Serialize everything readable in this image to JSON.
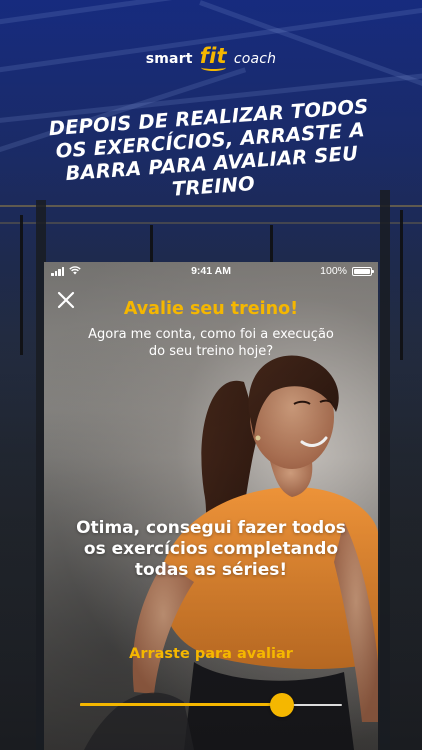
{
  "logo": {
    "smart": "smart",
    "fit": "fit",
    "coach": "coach"
  },
  "headline": "DEPOIS DE REALIZAR TODOS OS EXERCÍCIOS, ARRASTE A BARRA PARA AVALIAR SEU TREINO",
  "status_bar": {
    "time": "9:41 AM",
    "battery_percent": "100%",
    "icons": [
      "signal-icon",
      "wifi-icon",
      "battery-icon"
    ]
  },
  "screen": {
    "close_icon": "close-icon",
    "title": "Avalie seu treino!",
    "subtitle": "Agora me conta, como foi a execução do seu treino hoje?",
    "rating_text": "Otima, consegui fazer todos os exercícios completando todas as séries!",
    "drag_label": "Arraste para avaliar",
    "slider_value": 0.77
  },
  "colors": {
    "accent": "#f5b700",
    "text": "#ffffff",
    "background_top": "#1a2f86"
  }
}
